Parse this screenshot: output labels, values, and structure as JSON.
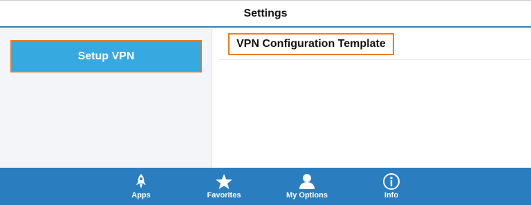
{
  "header": {
    "title": "Settings"
  },
  "sidebar": {
    "setup_vpn_label": "Setup VPN"
  },
  "main": {
    "vpn_template_label": "VPN Configuration Template"
  },
  "tabbar": {
    "items": [
      {
        "label": "Apps",
        "icon": "rocket-icon"
      },
      {
        "label": "Favorites",
        "icon": "star-icon"
      },
      {
        "label": "My Options",
        "icon": "person-icon"
      },
      {
        "label": "Info",
        "icon": "info-icon"
      }
    ]
  },
  "colors": {
    "accent_blue": "#2a7dbf",
    "button_blue": "#36a9e1",
    "highlight_orange": "#f07a1e"
  }
}
